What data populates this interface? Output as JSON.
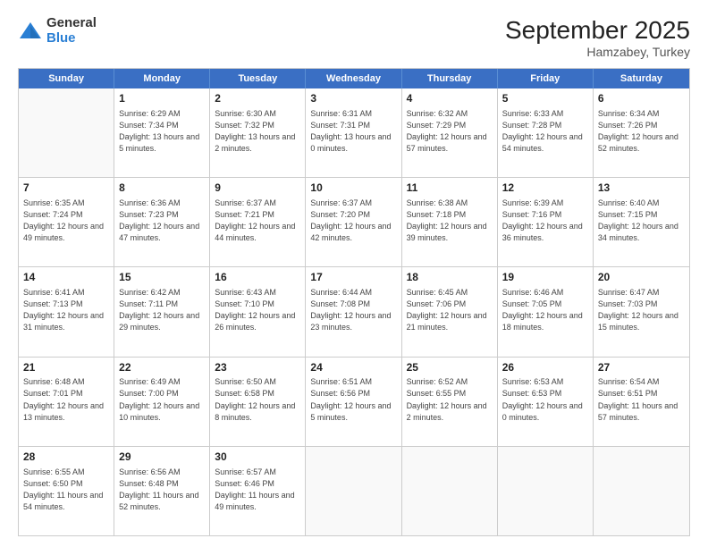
{
  "logo": {
    "general": "General",
    "blue": "Blue"
  },
  "title": "September 2025",
  "subtitle": "Hamzabey, Turkey",
  "days": [
    "Sunday",
    "Monday",
    "Tuesday",
    "Wednesday",
    "Thursday",
    "Friday",
    "Saturday"
  ],
  "rows": [
    [
      {
        "num": "",
        "empty": true
      },
      {
        "num": "1",
        "sunrise": "Sunrise: 6:29 AM",
        "sunset": "Sunset: 7:34 PM",
        "daylight": "Daylight: 13 hours and 5 minutes."
      },
      {
        "num": "2",
        "sunrise": "Sunrise: 6:30 AM",
        "sunset": "Sunset: 7:32 PM",
        "daylight": "Daylight: 13 hours and 2 minutes."
      },
      {
        "num": "3",
        "sunrise": "Sunrise: 6:31 AM",
        "sunset": "Sunset: 7:31 PM",
        "daylight": "Daylight: 13 hours and 0 minutes."
      },
      {
        "num": "4",
        "sunrise": "Sunrise: 6:32 AM",
        "sunset": "Sunset: 7:29 PM",
        "daylight": "Daylight: 12 hours and 57 minutes."
      },
      {
        "num": "5",
        "sunrise": "Sunrise: 6:33 AM",
        "sunset": "Sunset: 7:28 PM",
        "daylight": "Daylight: 12 hours and 54 minutes."
      },
      {
        "num": "6",
        "sunrise": "Sunrise: 6:34 AM",
        "sunset": "Sunset: 7:26 PM",
        "daylight": "Daylight: 12 hours and 52 minutes."
      }
    ],
    [
      {
        "num": "7",
        "sunrise": "Sunrise: 6:35 AM",
        "sunset": "Sunset: 7:24 PM",
        "daylight": "Daylight: 12 hours and 49 minutes."
      },
      {
        "num": "8",
        "sunrise": "Sunrise: 6:36 AM",
        "sunset": "Sunset: 7:23 PM",
        "daylight": "Daylight: 12 hours and 47 minutes."
      },
      {
        "num": "9",
        "sunrise": "Sunrise: 6:37 AM",
        "sunset": "Sunset: 7:21 PM",
        "daylight": "Daylight: 12 hours and 44 minutes."
      },
      {
        "num": "10",
        "sunrise": "Sunrise: 6:37 AM",
        "sunset": "Sunset: 7:20 PM",
        "daylight": "Daylight: 12 hours and 42 minutes."
      },
      {
        "num": "11",
        "sunrise": "Sunrise: 6:38 AM",
        "sunset": "Sunset: 7:18 PM",
        "daylight": "Daylight: 12 hours and 39 minutes."
      },
      {
        "num": "12",
        "sunrise": "Sunrise: 6:39 AM",
        "sunset": "Sunset: 7:16 PM",
        "daylight": "Daylight: 12 hours and 36 minutes."
      },
      {
        "num": "13",
        "sunrise": "Sunrise: 6:40 AM",
        "sunset": "Sunset: 7:15 PM",
        "daylight": "Daylight: 12 hours and 34 minutes."
      }
    ],
    [
      {
        "num": "14",
        "sunrise": "Sunrise: 6:41 AM",
        "sunset": "Sunset: 7:13 PM",
        "daylight": "Daylight: 12 hours and 31 minutes."
      },
      {
        "num": "15",
        "sunrise": "Sunrise: 6:42 AM",
        "sunset": "Sunset: 7:11 PM",
        "daylight": "Daylight: 12 hours and 29 minutes."
      },
      {
        "num": "16",
        "sunrise": "Sunrise: 6:43 AM",
        "sunset": "Sunset: 7:10 PM",
        "daylight": "Daylight: 12 hours and 26 minutes."
      },
      {
        "num": "17",
        "sunrise": "Sunrise: 6:44 AM",
        "sunset": "Sunset: 7:08 PM",
        "daylight": "Daylight: 12 hours and 23 minutes."
      },
      {
        "num": "18",
        "sunrise": "Sunrise: 6:45 AM",
        "sunset": "Sunset: 7:06 PM",
        "daylight": "Daylight: 12 hours and 21 minutes."
      },
      {
        "num": "19",
        "sunrise": "Sunrise: 6:46 AM",
        "sunset": "Sunset: 7:05 PM",
        "daylight": "Daylight: 12 hours and 18 minutes."
      },
      {
        "num": "20",
        "sunrise": "Sunrise: 6:47 AM",
        "sunset": "Sunset: 7:03 PM",
        "daylight": "Daylight: 12 hours and 15 minutes."
      }
    ],
    [
      {
        "num": "21",
        "sunrise": "Sunrise: 6:48 AM",
        "sunset": "Sunset: 7:01 PM",
        "daylight": "Daylight: 12 hours and 13 minutes."
      },
      {
        "num": "22",
        "sunrise": "Sunrise: 6:49 AM",
        "sunset": "Sunset: 7:00 PM",
        "daylight": "Daylight: 12 hours and 10 minutes."
      },
      {
        "num": "23",
        "sunrise": "Sunrise: 6:50 AM",
        "sunset": "Sunset: 6:58 PM",
        "daylight": "Daylight: 12 hours and 8 minutes."
      },
      {
        "num": "24",
        "sunrise": "Sunrise: 6:51 AM",
        "sunset": "Sunset: 6:56 PM",
        "daylight": "Daylight: 12 hours and 5 minutes."
      },
      {
        "num": "25",
        "sunrise": "Sunrise: 6:52 AM",
        "sunset": "Sunset: 6:55 PM",
        "daylight": "Daylight: 12 hours and 2 minutes."
      },
      {
        "num": "26",
        "sunrise": "Sunrise: 6:53 AM",
        "sunset": "Sunset: 6:53 PM",
        "daylight": "Daylight: 12 hours and 0 minutes."
      },
      {
        "num": "27",
        "sunrise": "Sunrise: 6:54 AM",
        "sunset": "Sunset: 6:51 PM",
        "daylight": "Daylight: 11 hours and 57 minutes."
      }
    ],
    [
      {
        "num": "28",
        "sunrise": "Sunrise: 6:55 AM",
        "sunset": "Sunset: 6:50 PM",
        "daylight": "Daylight: 11 hours and 54 minutes."
      },
      {
        "num": "29",
        "sunrise": "Sunrise: 6:56 AM",
        "sunset": "Sunset: 6:48 PM",
        "daylight": "Daylight: 11 hours and 52 minutes."
      },
      {
        "num": "30",
        "sunrise": "Sunrise: 6:57 AM",
        "sunset": "Sunset: 6:46 PM",
        "daylight": "Daylight: 11 hours and 49 minutes."
      },
      {
        "num": "",
        "empty": true
      },
      {
        "num": "",
        "empty": true
      },
      {
        "num": "",
        "empty": true
      },
      {
        "num": "",
        "empty": true
      }
    ]
  ]
}
